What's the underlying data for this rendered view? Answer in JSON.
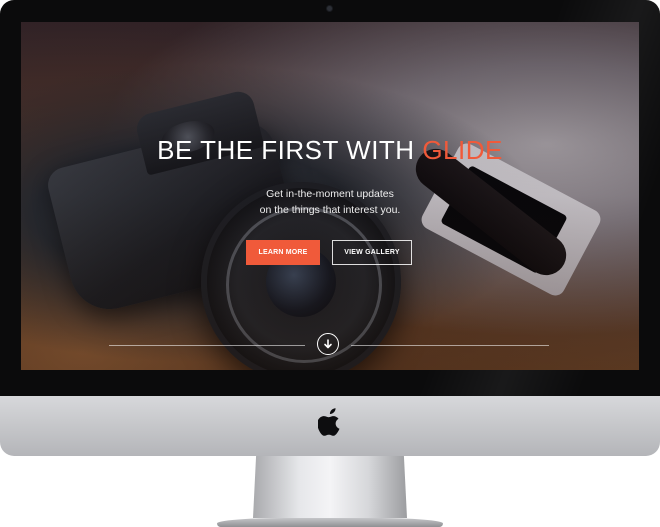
{
  "hero": {
    "title_main": "BE THE FIRST WITH",
    "title_accent": "GLIDE",
    "subtitle_line1": "Get in-the-moment updates",
    "subtitle_line2": "on the things that interest you."
  },
  "buttons": {
    "learn_more": "LEARN MORE",
    "view_gallery": "VIEW GALLERY"
  },
  "icons": {
    "scroll_down": "arrow-down-circle-icon",
    "brand": "apple-logo-icon",
    "webcam": "webcam-dot"
  },
  "colors": {
    "accent": "#f05a3a",
    "bezel": "#0b0b0c",
    "chin": "#cfd0d3"
  }
}
